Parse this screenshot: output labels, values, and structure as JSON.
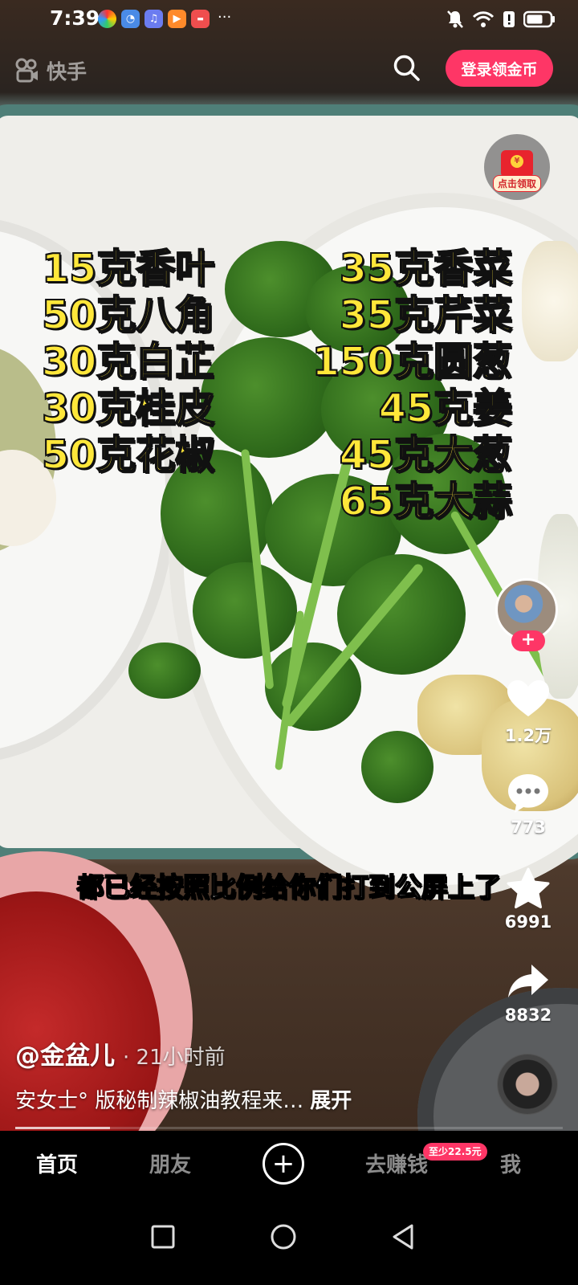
{
  "status_bar": {
    "time": "7:39",
    "notification_icons": [
      "app-icon-colorful",
      "app-icon-browser",
      "app-icon-music",
      "app-icon-video",
      "app-icon-red"
    ],
    "overflow": "···",
    "right_icons": [
      "mute-bell-icon",
      "wifi-icon",
      "alert-icon",
      "battery-icon"
    ]
  },
  "top_bar": {
    "app_name": "快手",
    "search_icon": "search-icon",
    "login_button": "登录领金币"
  },
  "red_packet": {
    "label": "点击领取"
  },
  "recipe_overlay": {
    "left": [
      "15克香叶",
      "50克八角",
      "30克白芷",
      "30克桂皮",
      "50克花椒"
    ],
    "right": [
      "35克香菜",
      "35克芹菜",
      "150克圆葱",
      "45克姜",
      "45克大葱",
      "65克大蒜"
    ]
  },
  "subtitle": "都已经按照比例给你们打到公屏上了",
  "actions": {
    "follow": "+",
    "like_count": "1.2万",
    "comment_count": "773",
    "favorite_count": "6991",
    "share_count": "8832"
  },
  "video_info": {
    "author": "@金盆儿",
    "time_ago": "· 21小时前",
    "caption": "安女士°  版秘制辣椒油教程来…",
    "expand": "展开"
  },
  "tab_bar": {
    "tabs": [
      "首页",
      "朋友",
      "去赚钱",
      "我"
    ],
    "active": "首页",
    "earn_badge": "至少22.5元",
    "create": "+"
  },
  "colors": {
    "accent": "#fe3666",
    "recipe_text": "#ffe73a"
  }
}
